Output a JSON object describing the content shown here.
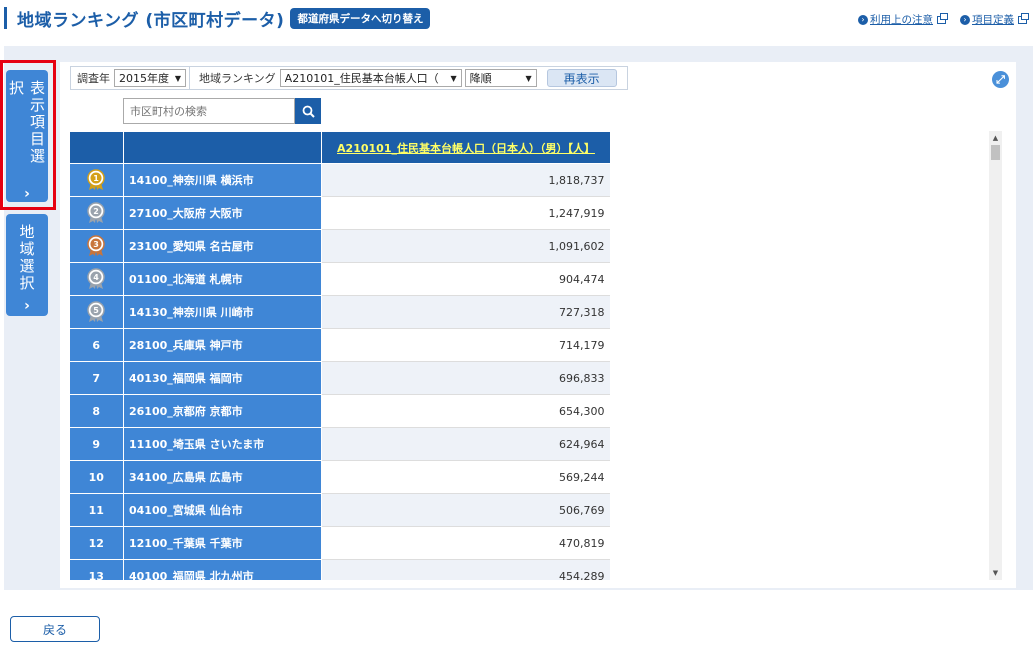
{
  "header": {
    "title": "地域ランキング (市区町村データ)",
    "switch_button": "都道府県データへ切り替え",
    "links": [
      "利用上の注意",
      "項目定義"
    ]
  },
  "side_tabs": {
    "display_items": {
      "label": "表示項目選択",
      "chevron": "›"
    },
    "region_select": {
      "label": "地域選択",
      "chevron": "›"
    }
  },
  "toolbar": {
    "year_label": "調査年",
    "year_value": "2015年度",
    "ranking_label": "地域ランキング",
    "item_value": "A210101_住民基本台帳人口（",
    "order_value": "降順",
    "reload_button": "再表示"
  },
  "search": {
    "placeholder": "市区町村の検索"
  },
  "table": {
    "value_header": "A210101_住民基本台帳人口（日本人）（男）【人】",
    "rows": [
      {
        "rank": "1",
        "medal": "gold",
        "name": "14100_神奈川県 横浜市",
        "value": "1,818,737"
      },
      {
        "rank": "2",
        "medal": "silver",
        "name": "27100_大阪府 大阪市",
        "value": "1,247,919"
      },
      {
        "rank": "3",
        "medal": "bronze",
        "name": "23100_愛知県 名古屋市",
        "value": "1,091,602"
      },
      {
        "rank": "4",
        "medal": "plain",
        "name": "01100_北海道 札幌市",
        "value": "904,474"
      },
      {
        "rank": "5",
        "medal": "plain",
        "name": "14130_神奈川県 川崎市",
        "value": "727,318"
      },
      {
        "rank": "6",
        "medal": "",
        "name": "28100_兵庫県 神戸市",
        "value": "714,179"
      },
      {
        "rank": "7",
        "medal": "",
        "name": "40130_福岡県 福岡市",
        "value": "696,833"
      },
      {
        "rank": "8",
        "medal": "",
        "name": "26100_京都府 京都市",
        "value": "654,300"
      },
      {
        "rank": "9",
        "medal": "",
        "name": "11100_埼玉県 さいたま市",
        "value": "624,964"
      },
      {
        "rank": "10",
        "medal": "",
        "name": "34100_広島県 広島市",
        "value": "569,244"
      },
      {
        "rank": "11",
        "medal": "",
        "name": "04100_宮城県 仙台市",
        "value": "506,769"
      },
      {
        "rank": "12",
        "medal": "",
        "name": "12100_千葉県 千葉市",
        "value": "470,819"
      },
      {
        "rank": "13",
        "medal": "",
        "name": "40100_福岡県 北九州市",
        "value": "454,289"
      }
    ]
  },
  "back_button": "戻る",
  "colors": {
    "primary": "#1c5ea8",
    "row_blue": "#3f86d6",
    "highlight_red": "#e60012",
    "header_link_text": "#ffff66",
    "gold": "#d4a017",
    "silver": "#9aa3ad",
    "bronze": "#c8753d"
  }
}
